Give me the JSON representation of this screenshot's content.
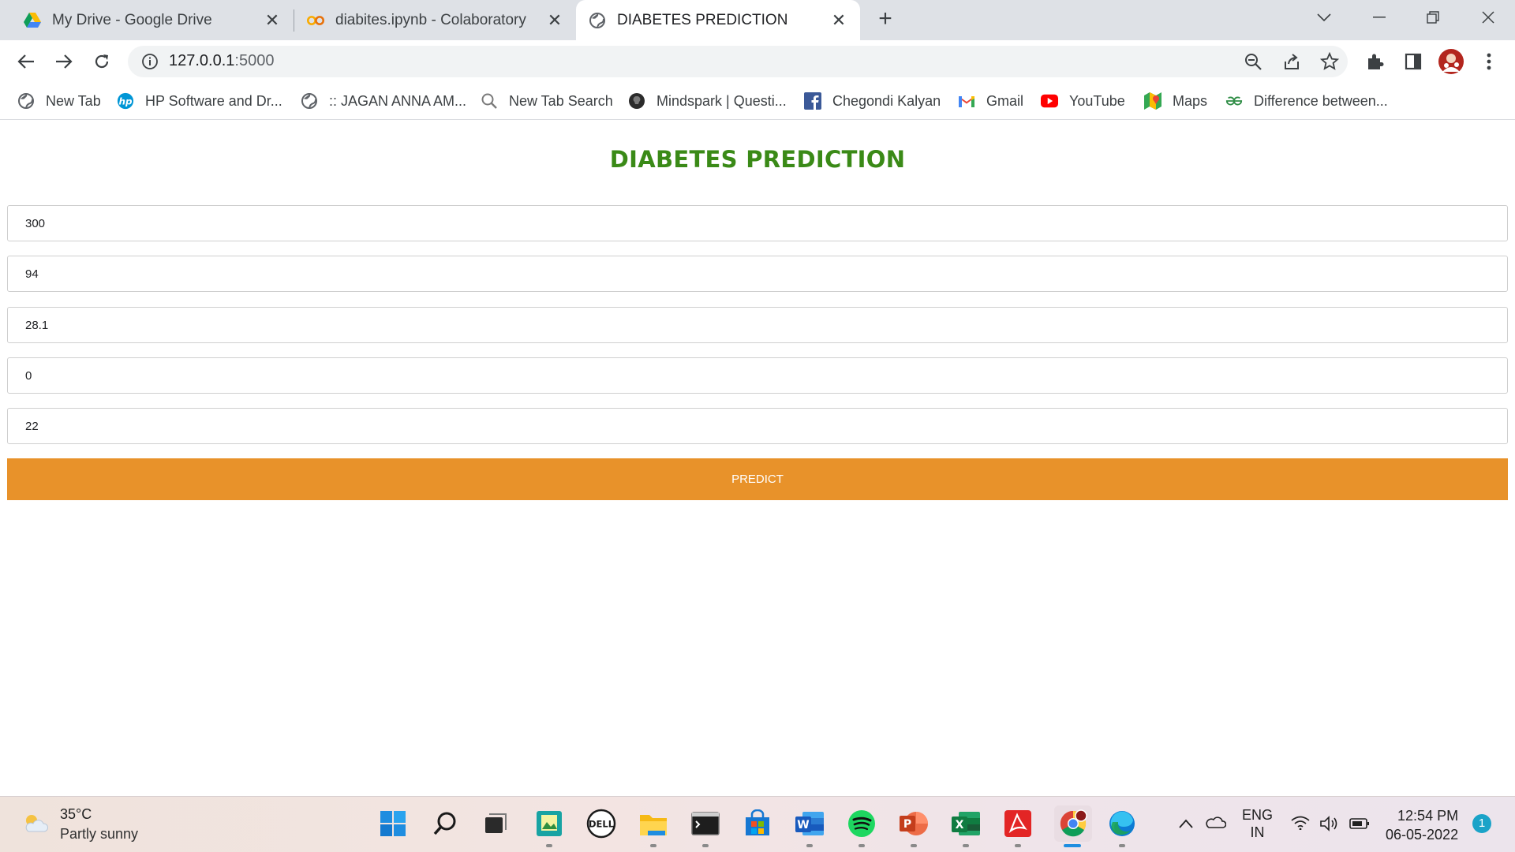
{
  "browser": {
    "tabs": [
      {
        "title": "My Drive - Google Drive",
        "icon": "google-drive-icon",
        "active": false
      },
      {
        "title": "diabites.ipynb - Colaboratory",
        "icon": "colab-icon",
        "active": false
      },
      {
        "title": "DIABETES PREDICTION",
        "icon": "globe-icon",
        "active": true
      }
    ],
    "new_tab": "+",
    "address": {
      "host": "127.0.0.1",
      "port": ":5000"
    },
    "bookmarks": [
      {
        "label": "New Tab",
        "icon": "globe-icon"
      },
      {
        "label": "HP Software and Dr...",
        "icon": "hp-icon"
      },
      {
        "label": ":: JAGAN ANNA AM...",
        "icon": "globe-icon"
      },
      {
        "label": "New Tab Search",
        "icon": "search-icon"
      },
      {
        "label": "Mindspark | Questi...",
        "icon": "mindspark-icon"
      },
      {
        "label": "Chegondi Kalyan",
        "icon": "facebook-icon"
      },
      {
        "label": "Gmail",
        "icon": "gmail-icon"
      },
      {
        "label": "YouTube",
        "icon": "youtube-icon"
      },
      {
        "label": "Maps",
        "icon": "maps-icon"
      },
      {
        "label": "Difference between...",
        "icon": "geeksforgeeks-icon"
      }
    ]
  },
  "page": {
    "title": "DIABETES PREDICTION",
    "fields": [
      "300",
      "94",
      "28.1",
      "0",
      "22"
    ],
    "predict_label": "PREDICT",
    "title_color": "#3a8a17",
    "button_color": "#e8922a"
  },
  "taskbar": {
    "weather": {
      "temp": "35°C",
      "condition": "Partly sunny"
    },
    "language": {
      "line1": "ENG",
      "line2": "IN"
    },
    "time": "12:54 PM",
    "date": "06-05-2022",
    "notifications": "1"
  }
}
